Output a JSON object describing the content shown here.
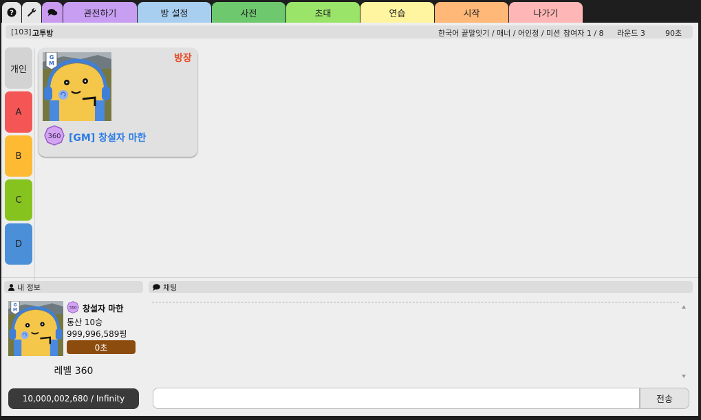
{
  "app": {
    "colors": {
      "background": "#1e1e1e",
      "panel": "#eeeeee",
      "badge_purple": "#c78fea",
      "gm_blue": "#2a7ae2",
      "host_red": "#e84e2a",
      "timer_brown": "#8b4c0e"
    }
  },
  "topbar": {
    "icon_tabs": [
      {
        "icon": "help-icon",
        "color": "#e6e6e6"
      },
      {
        "icon": "wrench-icon",
        "color": "#e6e6e6"
      },
      {
        "icon": "chat-bubbles-icon",
        "color": "#c99af0"
      }
    ],
    "tabs": [
      {
        "label": "관전하기",
        "color": "#c79ef2"
      },
      {
        "label": "방 설정",
        "color": "#a8cff0"
      },
      {
        "label": "사전",
        "color": "#6ec96e"
      },
      {
        "label": "초대",
        "color": "#9ae46a"
      },
      {
        "label": "연습",
        "color": "#fff5a0"
      },
      {
        "label": "시작",
        "color": "#ffb877"
      },
      {
        "label": "나가기",
        "color": "#ffb6b6"
      }
    ]
  },
  "room": {
    "number": "[103]",
    "name": "고투방",
    "mode": "한국어 끝말잇기 / 매너 / 어인정 / 미션",
    "players": "참여자 1 / 8",
    "round": "라운드 3",
    "time": "90초"
  },
  "teams": [
    {
      "label": "개인",
      "color": "#d3d3d3"
    },
    {
      "label": "A",
      "color": "#f45656"
    },
    {
      "label": "B",
      "color": "#ffba33"
    },
    {
      "label": "C",
      "color": "#86c31f"
    },
    {
      "label": "D",
      "color": "#4a8fd8"
    }
  ],
  "player_card": {
    "host_label": "방장",
    "level": "360",
    "name": "[GM] 창설자 마한",
    "gm_mark": "G M"
  },
  "my_info": {
    "header": "내 정보",
    "level_badge": "360",
    "name": "창설자 마한",
    "record": "통산 10승",
    "ping": "999,996,589핑",
    "timer": "0초",
    "level_text": "레벨 360",
    "exp": "10,000,002,680 / Infinity"
  },
  "chat": {
    "header": "채팅",
    "input_value": "",
    "send_label": "전송"
  }
}
